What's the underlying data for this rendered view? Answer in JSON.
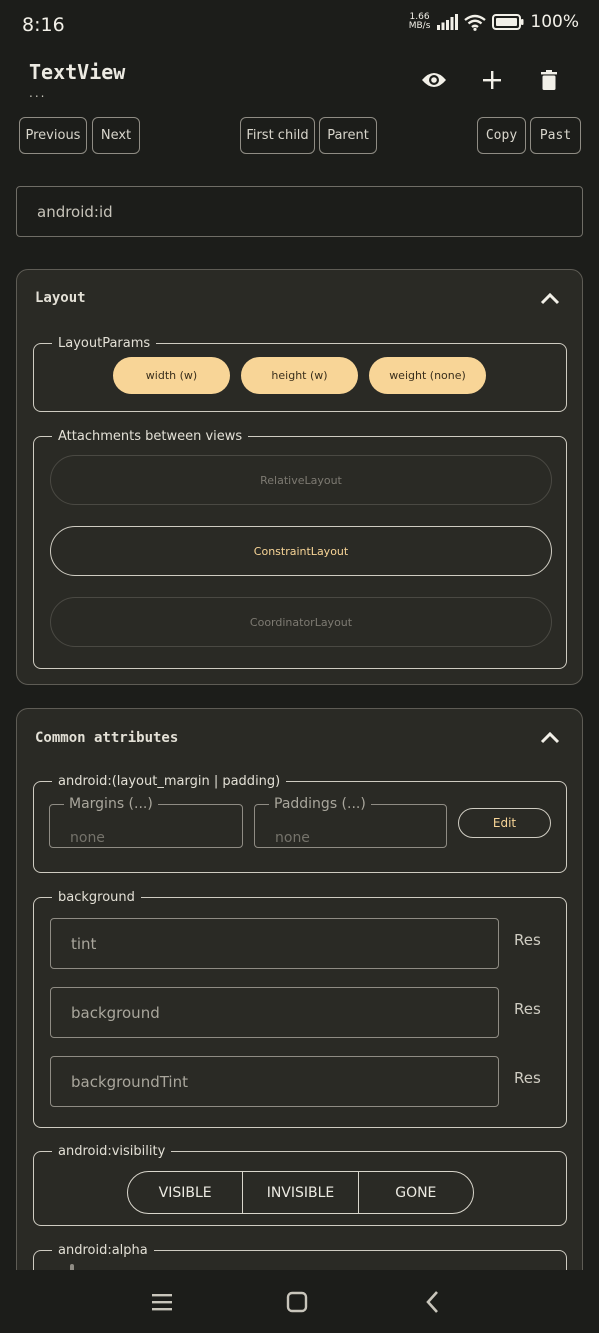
{
  "status": {
    "time": "8:16",
    "net_value": "1.66",
    "net_unit": "MB/s",
    "battery": "100%"
  },
  "header": {
    "title": "TextView",
    "subtitle": "...",
    "icons": [
      "eye-icon",
      "plus-icon",
      "trash-icon"
    ]
  },
  "nav": {
    "previous": "Previous",
    "next": "Next",
    "first_child": "First child",
    "parent": "Parent",
    "copy": "Copy",
    "paste": "Past"
  },
  "id_field": {
    "value": "android:id"
  },
  "layout_card": {
    "title": "Layout",
    "layout_params": {
      "legend": "LayoutParams",
      "chips": [
        "width (w)",
        "height (w)",
        "weight (none)"
      ]
    },
    "attachments": {
      "legend": "Attachments between views",
      "options": [
        "RelativeLayout",
        "ConstraintLayout",
        "CoordinatorLayout"
      ],
      "selected": "ConstraintLayout"
    }
  },
  "common_card": {
    "title": "Common attributes",
    "margin_padding": {
      "legend": "android:(layout_margin | padding)",
      "margins_label": "Margins (...)",
      "margins_value": "none",
      "paddings_label": "Paddings (...)",
      "paddings_value": "none",
      "edit": "Edit"
    },
    "background": {
      "legend": "background",
      "fields": [
        "tint",
        "background",
        "backgroundTint"
      ],
      "res": "Res"
    },
    "visibility": {
      "legend": "android:visibility",
      "options": [
        "VISIBLE",
        "INVISIBLE",
        "GONE"
      ]
    },
    "alpha": {
      "legend": "android:alpha"
    }
  },
  "colors": {
    "background": "#1c1d1a",
    "card": "#2a2a25",
    "accent": "#f8d597"
  }
}
